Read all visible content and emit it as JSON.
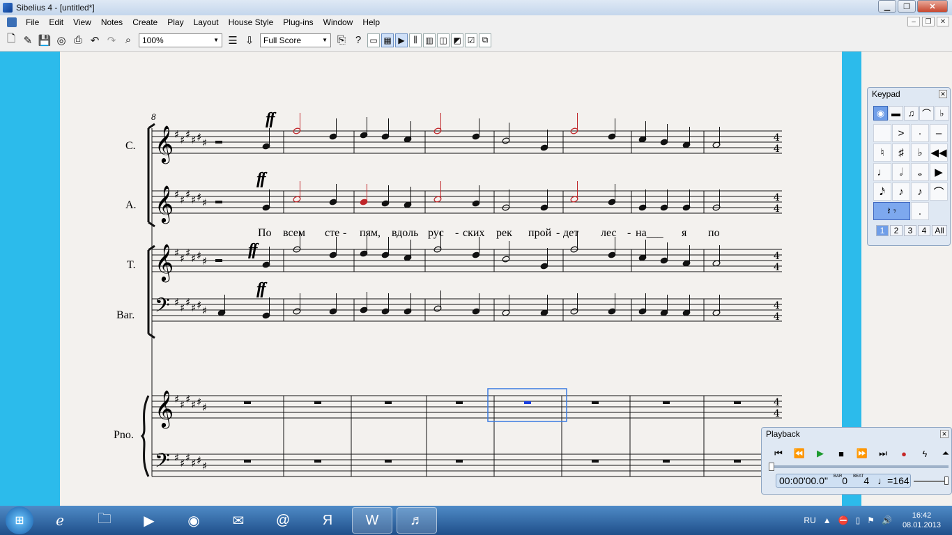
{
  "window": {
    "title": "Sibelius 4 - [untitled*]"
  },
  "menu": [
    "File",
    "Edit",
    "View",
    "Notes",
    "Create",
    "Play",
    "Layout",
    "House Style",
    "Plug-ins",
    "Window",
    "Help"
  ],
  "toolbar": {
    "zoom": "100%",
    "score_view": "Full Score"
  },
  "score": {
    "bar_number": "8",
    "dynamic": "ff",
    "staves": [
      {
        "label": "C."
      },
      {
        "label": "A."
      },
      {
        "label": "T."
      },
      {
        "label": "Bar."
      },
      {
        "label": "Pno."
      }
    ],
    "lyrics": [
      "По",
      "всем",
      "сте",
      "-",
      "пям,",
      "вдоль",
      "рус",
      "-",
      "ских",
      "рек",
      "прой",
      "-",
      "дет",
      "лес",
      "-",
      "на___",
      "я",
      "по"
    ]
  },
  "keypad": {
    "title": "Keypad",
    "layers": [
      "1",
      "2",
      "3",
      "4",
      "All"
    ]
  },
  "playback": {
    "title": "Playback",
    "time": "00:00'00.0\"",
    "bar_label": "BAR",
    "bar_value": "0",
    "beat_label": "BEAT",
    "beat_value": "4",
    "tempo": "♩=164"
  },
  "taskbar": {
    "language": "RU",
    "time": "16:42",
    "date": "08.01.2013"
  },
  "colors": {
    "workspace": "#2cbbeb",
    "paper": "#f3f1ee",
    "selection": "#3a7be0",
    "highlight_note": "#c0262a"
  }
}
